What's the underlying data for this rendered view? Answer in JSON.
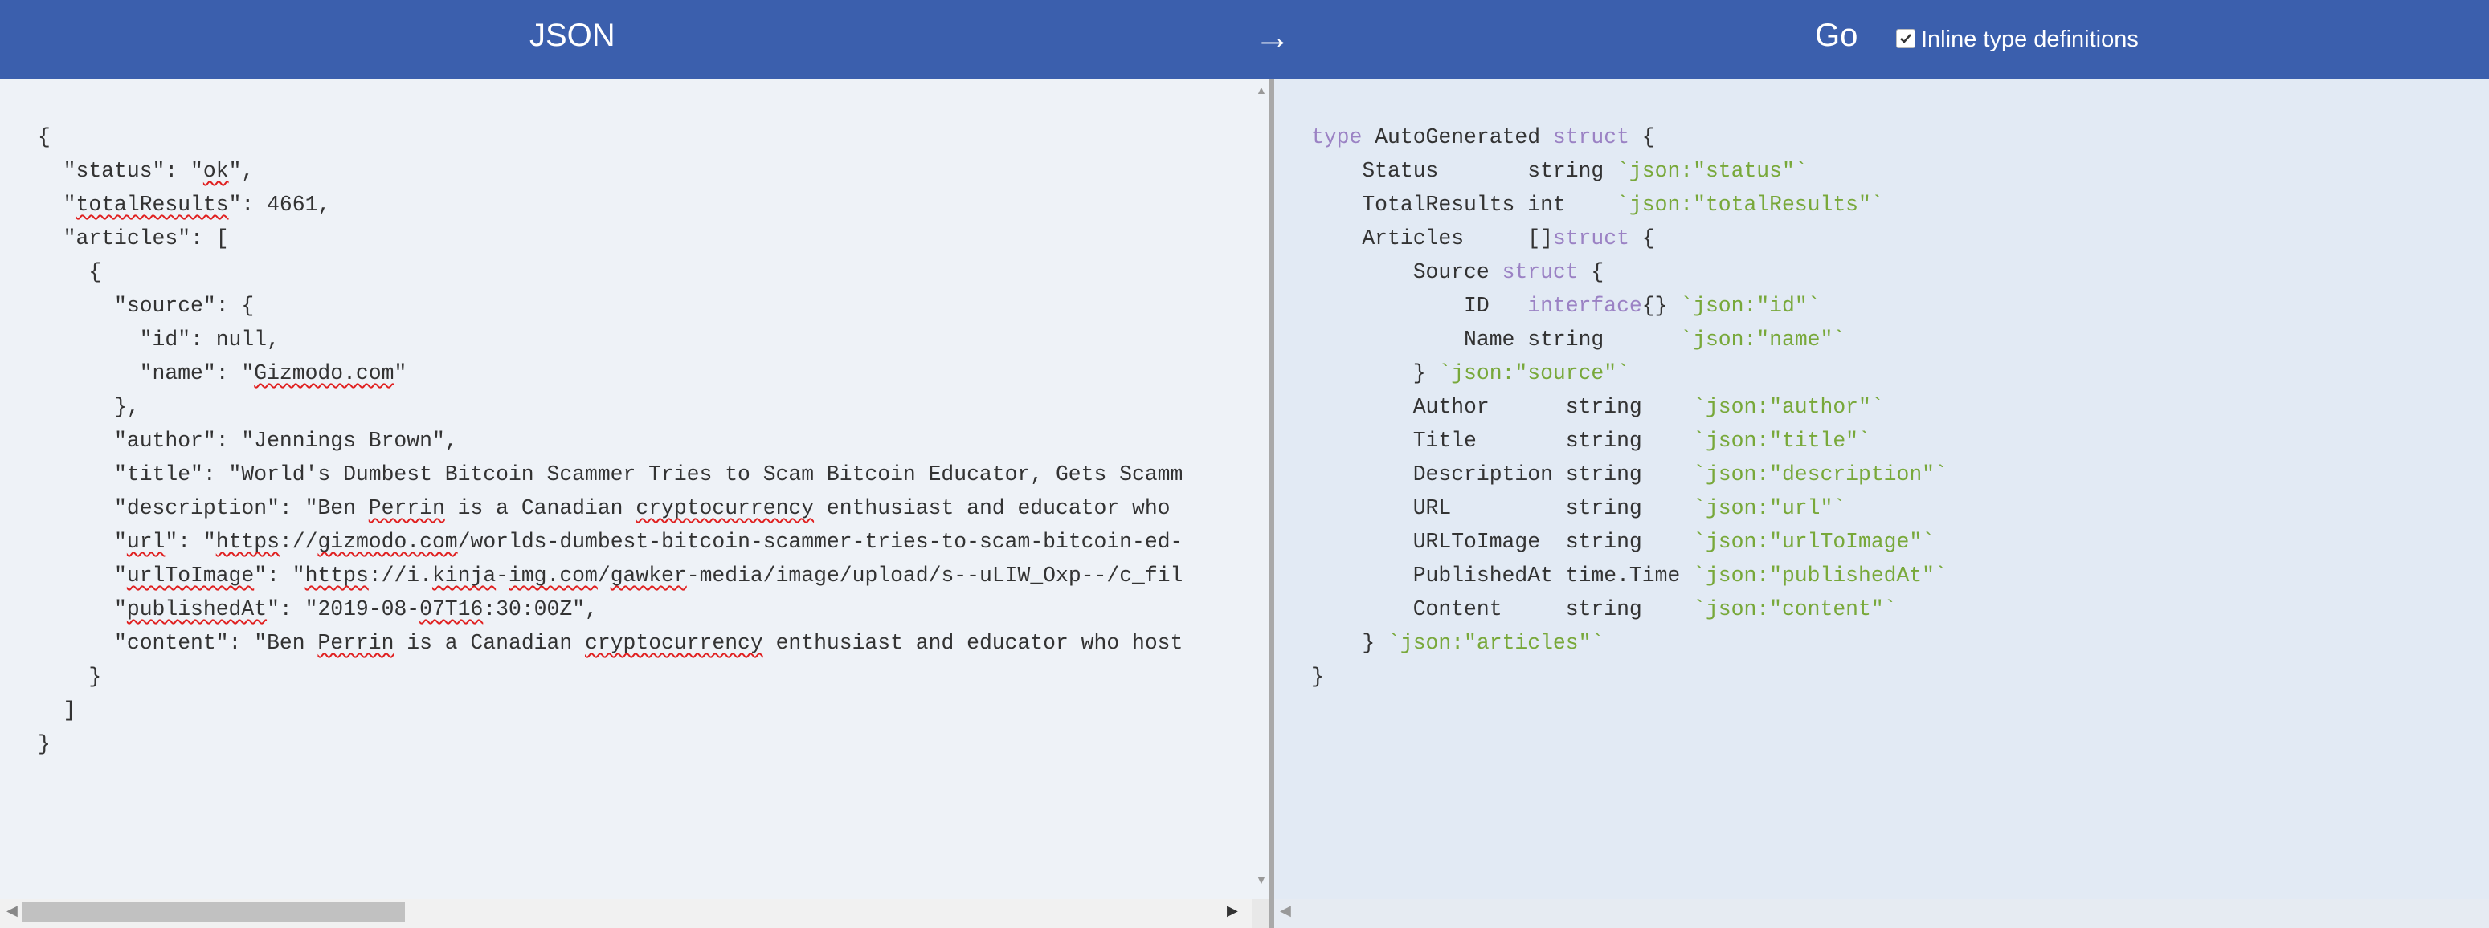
{
  "header": {
    "input_label": "JSON",
    "arrow": "→",
    "output_label": "Go",
    "inline_checkbox_label": "Inline type definitions",
    "inline_checked": true,
    "bg_color": "#3b5fad"
  },
  "json_input": {
    "lines": [
      "{",
      "  \"status\": \"ok\",",
      "  \"totalResults\": 4661,",
      "  \"articles\": [",
      "    {",
      "      \"source\": {",
      "        \"id\": null,",
      "        \"name\": \"Gizmodo.com\"",
      "      },",
      "      \"author\": \"Jennings Brown\",",
      "      \"title\": \"World's Dumbest Bitcoin Scammer Tries to Scam Bitcoin Educator, Gets Scamm",
      "      \"description\": \"Ben Perrin is a Canadian cryptocurrency enthusiast and educator who ",
      "      \"url\": \"https://gizmodo.com/worlds-dumbest-bitcoin-scammer-tries-to-scam-bitcoin-ed-",
      "      \"urlToImage\": \"https://i.kinja-img.com/gawker-media/image/upload/s--uLIW_Oxp--/c_fil",
      "      \"publishedAt\": \"2019-08-07T16:30:00Z\",",
      "      \"content\": \"Ben Perrin is a Canadian cryptocurrency enthusiast and educator who host",
      "    }",
      "  ]",
      "}"
    ]
  },
  "go_output": {
    "lines": [
      "type AutoGenerated struct {",
      "    Status       string `json:\"status\"`",
      "    TotalResults int    `json:\"totalResults\"`",
      "    Articles     []struct {",
      "        Source struct {",
      "            ID   interface{} `json:\"id\"`",
      "            Name string      `json:\"name\"`",
      "        } `json:\"source\"`",
      "        Author      string    `json:\"author\"`",
      "        Title       string    `json:\"title\"`",
      "        Description string    `json:\"description\"`",
      "        URL         string    `json:\"url\"`",
      "        URLToImage  string    `json:\"urlToImage\"`",
      "        PublishedAt time.Time `json:\"publishedAt\"`",
      "        Content     string    `json:\"content\"`",
      "    } `json:\"articles\"`",
      "}"
    ],
    "keyword_color": "#9b82c4",
    "tag_color": "#78a83a"
  },
  "spellcheck_words": [
    "ok",
    "totalResults",
    "Gizmodo.com",
    "Perrin",
    "cryptocurrency",
    "url",
    "https",
    "gizmodo.com",
    "urlToImage",
    "kinja",
    "img.com",
    "gawker",
    "uLIW",
    "Oxp",
    "fil",
    "publishedAt",
    "07T16"
  ]
}
